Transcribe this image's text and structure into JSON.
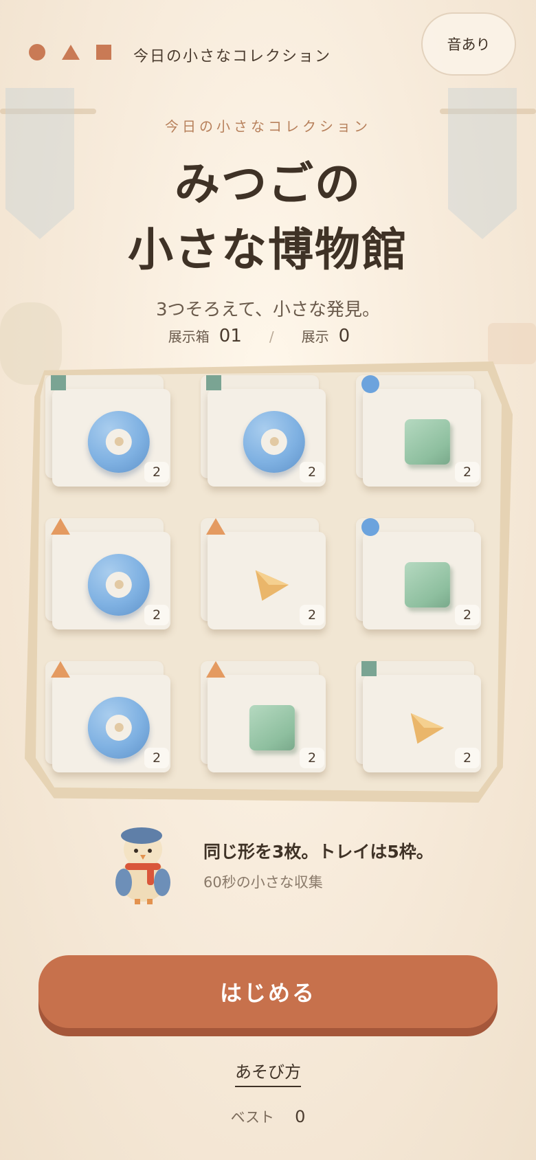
{
  "header": {
    "logo_shapes": [
      "circle",
      "triangle",
      "square"
    ],
    "title": "今日の小さなコレクション",
    "sound_label": "音あり"
  },
  "hero": {
    "kicker": "今日の小さなコレクション",
    "title_line1": "みつごの",
    "title_line2": "小さな博物館",
    "tagline": "3つそろえて、小さな発見。"
  },
  "stats": {
    "case_label": "展示箱",
    "case_value": "01",
    "separator": "/",
    "display_label": "展示",
    "display_value": "0"
  },
  "board": {
    "tiles": [
      {
        "tag": "square",
        "item": "ring",
        "count": "2"
      },
      {
        "tag": "square",
        "item": "ring",
        "count": "2"
      },
      {
        "tag": "circle",
        "item": "cube",
        "count": "2"
      },
      {
        "tag": "triangle",
        "item": "ring",
        "count": "2"
      },
      {
        "tag": "triangle",
        "item": "pyramid",
        "count": "2"
      },
      {
        "tag": "circle",
        "item": "cube",
        "count": "2"
      },
      {
        "tag": "triangle",
        "item": "ring",
        "count": "2"
      },
      {
        "tag": "triangle",
        "item": "cube",
        "count": "2"
      },
      {
        "tag": "square",
        "item": "pyramid",
        "count": "2"
      }
    ]
  },
  "hint": {
    "main": "同じ形を3枚。トレイは5枠。",
    "sub": "60秒の小さな収集"
  },
  "actions": {
    "start_label": "はじめる",
    "howto_label": "あそび方"
  },
  "best": {
    "label": "ベスト",
    "value": "0"
  },
  "colors": {
    "accent": "#c7714c",
    "ring": "#7fb1e2",
    "cube": "#8ebf9f",
    "pyramid": "#eab66a",
    "tag_square": "#7aa493",
    "tag_circle": "#6ca3dd",
    "tag_triangle": "#e49a60"
  }
}
